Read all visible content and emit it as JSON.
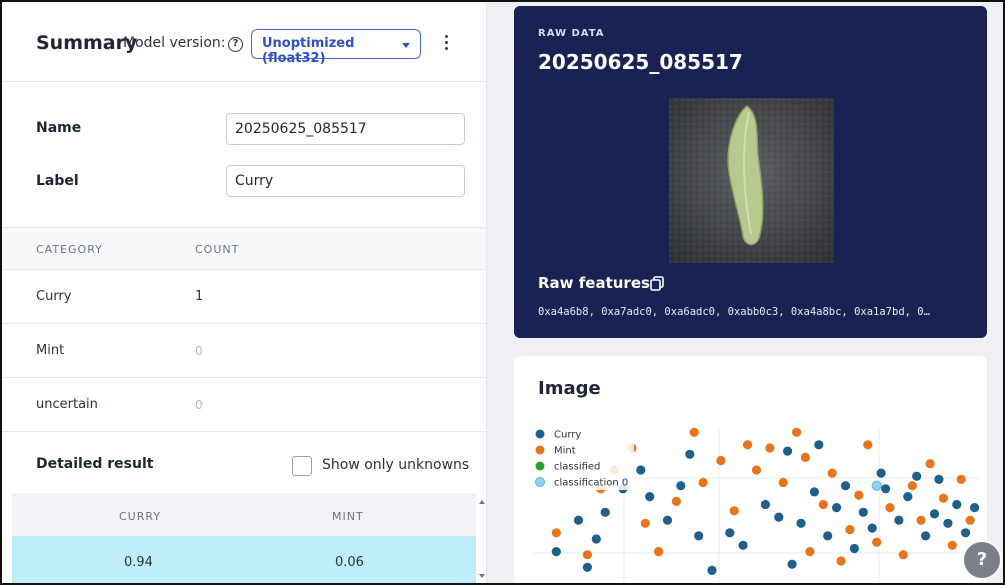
{
  "summary": {
    "title": "Summary",
    "model_version_label": "Model version:",
    "model_version_value": "Unoptimized (float32)"
  },
  "form": {
    "name_label": "Name",
    "name_value": "20250625_085517",
    "label_label": "Label",
    "label_value": "Curry"
  },
  "category_table": {
    "headers": [
      "CATEGORY",
      "COUNT"
    ],
    "rows": [
      {
        "category": "Curry",
        "count": "1"
      },
      {
        "category": "Mint",
        "count": "0"
      },
      {
        "category": "uncertain",
        "count": "0"
      }
    ]
  },
  "detailed": {
    "title": "Detailed result",
    "checkbox_label": "Show only unknowns",
    "headers": [
      "CURRY",
      "MINT"
    ],
    "row": [
      "0.94",
      "0.06"
    ]
  },
  "raw_data": {
    "tag": "RAW DATA",
    "title": "20250625_085517",
    "features_label": "Raw features",
    "features_value": "0xa4a6b8, 0xa7adc0, 0xa6adc0, 0xabb0c3, 0xa4a8bc, 0xa1a7bd, 0…"
  },
  "image_card": {
    "title": "Image"
  },
  "colors": {
    "accent": "#2f4fc8",
    "curry": "#1f5f8b",
    "mint": "#e8741c",
    "classified": "#2ca02c",
    "classification0": "#8fd3ec",
    "highlight_row": "#bfeef9",
    "raw_bg": "#1a2253"
  },
  "chart_data": {
    "type": "scatter",
    "legend_position": "top-left",
    "grid": true,
    "series": [
      {
        "name": "Curry",
        "color": "#1f5f8b",
        "points": [
          [
            0.12,
            0.1
          ],
          [
            0.14,
            0.28
          ],
          [
            0.1,
            0.4
          ],
          [
            0.16,
            0.45
          ],
          [
            0.2,
            0.6
          ],
          [
            0.24,
            0.72
          ],
          [
            0.26,
            0.55
          ],
          [
            0.3,
            0.4
          ],
          [
            0.33,
            0.62
          ],
          [
            0.37,
            0.3
          ],
          [
            0.4,
            0.08
          ],
          [
            0.44,
            0.32
          ],
          [
            0.47,
            0.24
          ],
          [
            0.52,
            0.5
          ],
          [
            0.55,
            0.42
          ],
          [
            0.57,
            0.84
          ],
          [
            0.58,
            0.12
          ],
          [
            0.6,
            0.38
          ],
          [
            0.63,
            0.58
          ],
          [
            0.66,
            0.3
          ],
          [
            0.68,
            0.48
          ],
          [
            0.7,
            0.62
          ],
          [
            0.72,
            0.22
          ],
          [
            0.74,
            0.45
          ],
          [
            0.76,
            0.35
          ],
          [
            0.79,
            0.6
          ],
          [
            0.82,
            0.4
          ],
          [
            0.84,
            0.55
          ],
          [
            0.86,
            0.68
          ],
          [
            0.88,
            0.3
          ],
          [
            0.9,
            0.44
          ],
          [
            0.93,
            0.38
          ],
          [
            0.95,
            0.5
          ],
          [
            0.97,
            0.32
          ],
          [
            0.99,
            0.48
          ],
          [
            0.91,
            0.66
          ],
          [
            0.78,
            0.7
          ],
          [
            0.64,
            0.88
          ],
          [
            0.35,
            0.82
          ],
          [
            0.05,
            0.2
          ]
        ]
      },
      {
        "name": "Mint",
        "color": "#e8741c",
        "points": [
          [
            0.05,
            0.32
          ],
          [
            0.12,
            0.18
          ],
          [
            0.15,
            0.6
          ],
          [
            0.18,
            0.72
          ],
          [
            0.25,
            0.38
          ],
          [
            0.28,
            0.2
          ],
          [
            0.32,
            0.52
          ],
          [
            0.38,
            0.64
          ],
          [
            0.42,
            0.78
          ],
          [
            0.45,
            0.46
          ],
          [
            0.48,
            0.88
          ],
          [
            0.5,
            0.72
          ],
          [
            0.53,
            0.86
          ],
          [
            0.56,
            0.64
          ],
          [
            0.59,
            0.96
          ],
          [
            0.61,
            0.8
          ],
          [
            0.62,
            0.2
          ],
          [
            0.65,
            0.5
          ],
          [
            0.67,
            0.7
          ],
          [
            0.69,
            0.14
          ],
          [
            0.71,
            0.34
          ],
          [
            0.73,
            0.56
          ],
          [
            0.75,
            0.88
          ],
          [
            0.77,
            0.26
          ],
          [
            0.8,
            0.48
          ],
          [
            0.83,
            0.18
          ],
          [
            0.85,
            0.62
          ],
          [
            0.87,
            0.4
          ],
          [
            0.89,
            0.76
          ],
          [
            0.92,
            0.54
          ],
          [
            0.94,
            0.24
          ],
          [
            0.96,
            0.66
          ],
          [
            0.98,
            0.4
          ],
          [
            0.36,
            0.96
          ],
          [
            0.22,
            0.86
          ]
        ]
      },
      {
        "name": "classified",
        "color": "#2ca02c",
        "points": []
      },
      {
        "name": "classification 0",
        "color": "#8fd3ec",
        "points": [
          [
            0.77,
            0.62
          ]
        ]
      }
    ]
  }
}
